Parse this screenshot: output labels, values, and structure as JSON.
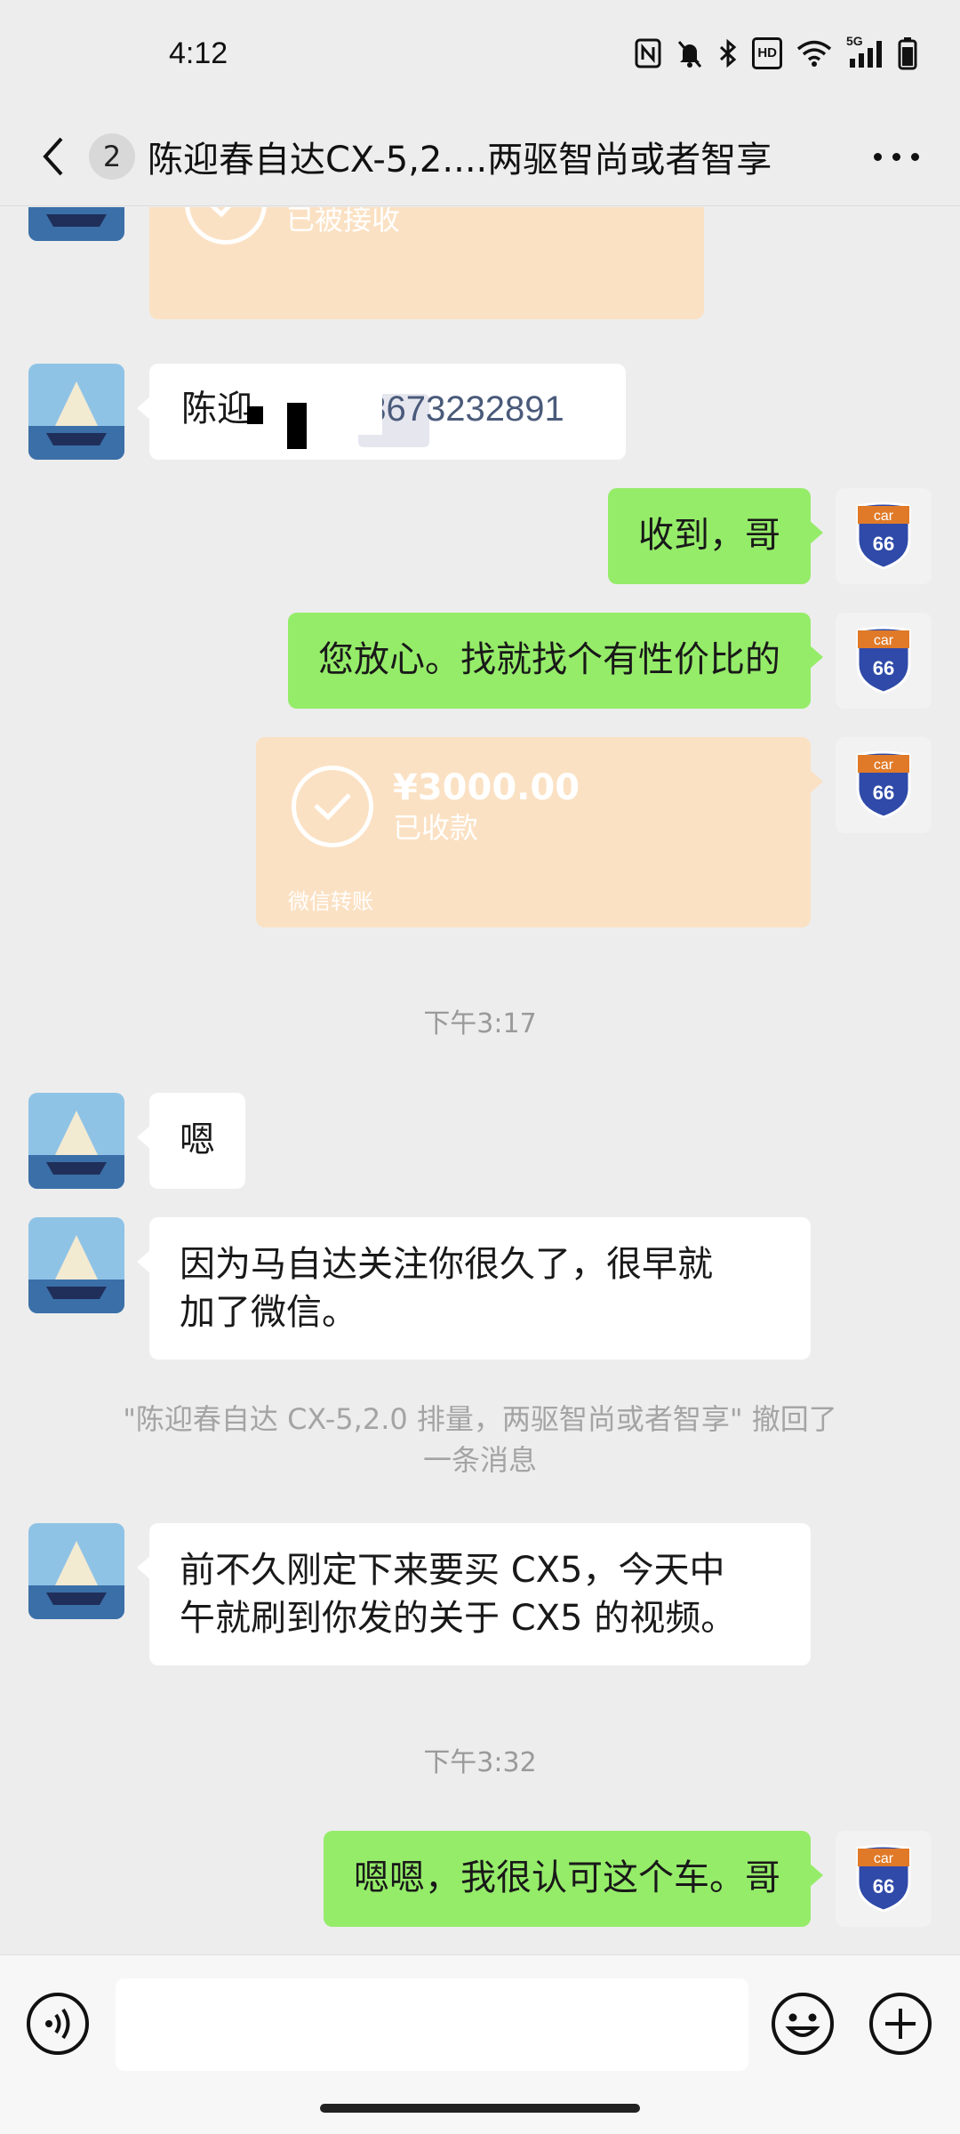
{
  "status_bar": {
    "time": "4:12",
    "icons": [
      "nfc-icon",
      "mute-icon",
      "bluetooth-icon",
      "hd-icon",
      "wifi-icon",
      "5g-signal-icon",
      "battery-icon"
    ],
    "hd_label": "HD",
    "network_label": "5G"
  },
  "header": {
    "unread_count": "2",
    "title": "陈迎春自达CX-5,2....两驱智尚或者智享"
  },
  "messages": [
    {
      "type": "transfer",
      "side": "left",
      "status": "已被接收",
      "partial": true
    },
    {
      "type": "text",
      "side": "left",
      "text_visible_start": "陈迎",
      "text_visible_end": "13673232891",
      "redacted": true
    },
    {
      "type": "text",
      "side": "right",
      "text": "收到，哥"
    },
    {
      "type": "text",
      "side": "right",
      "text": "您放心。找就找个有性价比的"
    },
    {
      "type": "transfer",
      "side": "right",
      "amount": "¥3000.00",
      "status": "已收款",
      "footer": "微信转账"
    },
    {
      "type": "time",
      "text": "下午3:17"
    },
    {
      "type": "text",
      "side": "left",
      "text": "嗯"
    },
    {
      "type": "text",
      "side": "left",
      "line1": "因为马自达关注你很久了，很早就",
      "line2": "加了微信。"
    },
    {
      "type": "system",
      "line1": "\"陈迎春自达 CX-5,2.0 排量，两驱智尚或者智享\" 撤回了",
      "line2": "一条消息"
    },
    {
      "type": "text",
      "side": "left",
      "line1": "前不久刚定下来要买 CX5，今天中",
      "line2": "午就刷到你发的关于 CX5 的视频。"
    },
    {
      "type": "time",
      "text": "下午3:32"
    },
    {
      "type": "text",
      "side": "right",
      "text": "嗯嗯，我很认可这个车。哥"
    }
  ],
  "avatar_right": {
    "badge_top": "car",
    "badge_number": "66"
  },
  "input_bar": {
    "placeholder": ""
  },
  "colors": {
    "background": "#ededed",
    "bubble_self": "#95ec69",
    "bubble_other": "#ffffff",
    "transfer": "#fbe1c3"
  }
}
